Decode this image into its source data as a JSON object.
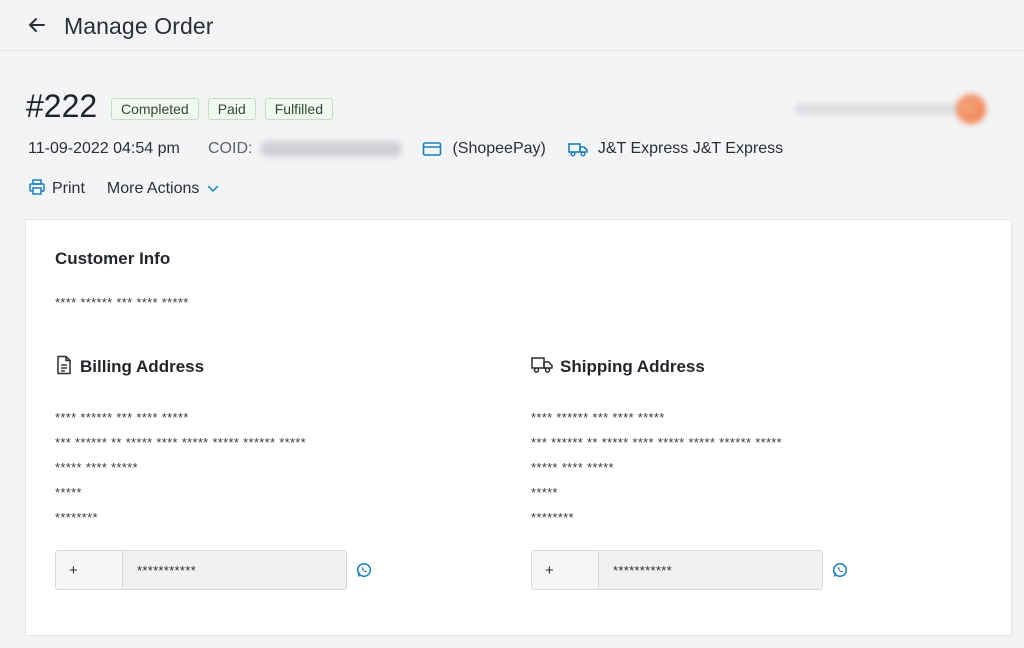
{
  "header": {
    "title": "Manage Order",
    "back_icon": "arrow-left-icon"
  },
  "order": {
    "number": "#222",
    "badges": [
      "Completed",
      "Paid",
      "Fulfilled"
    ],
    "date": "11-09-2022 04:54 pm",
    "coid_label": "COID:",
    "payment": "(ShopeePay)",
    "shipping": "J&T Express J&T Express"
  },
  "actions": {
    "print": "Print",
    "more": "More Actions"
  },
  "customer": {
    "title": "Customer Info",
    "line": "**** ****** *** **** *****"
  },
  "billing": {
    "title": "Billing Address",
    "lines": [
      "**** ****** *** **** *****",
      "*** ****** ** ***** **** ***** ***** ****** *****",
      "***** **** *****",
      "*****",
      "********"
    ],
    "phone_prefix": "+",
    "phone": "***********"
  },
  "shipping_address": {
    "title": "Shipping Address",
    "lines": [
      "**** ****** *** **** *****",
      "*** ****** ** ***** **** ***** ***** ****** *****",
      "***** **** *****",
      "*****",
      "********"
    ],
    "phone_prefix": "+",
    "phone": "***********"
  },
  "colors": {
    "accent": "#1a7fc1",
    "badge_bg": "#f0f8ef",
    "badge_border": "#bfe0c2"
  }
}
